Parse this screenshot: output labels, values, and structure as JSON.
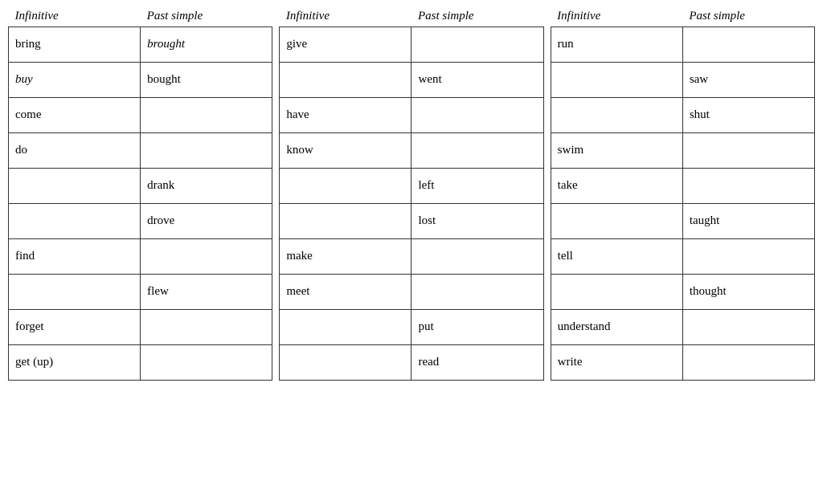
{
  "tables": [
    {
      "id": "table1",
      "headers": [
        "Infinitive",
        "Past simple"
      ],
      "rows": [
        {
          "infinitive": "bring",
          "infinitive_italic": false,
          "past_simple": "brought",
          "past_italic": true
        },
        {
          "infinitive": "buy",
          "infinitive_italic": true,
          "past_simple": "bought",
          "past_italic": false
        },
        {
          "infinitive": "come",
          "infinitive_italic": false,
          "past_simple": "",
          "past_italic": false
        },
        {
          "infinitive": "do",
          "infinitive_italic": false,
          "past_simple": "",
          "past_italic": false
        },
        {
          "infinitive": "",
          "infinitive_italic": false,
          "past_simple": "drank",
          "past_italic": false
        },
        {
          "infinitive": "",
          "infinitive_italic": false,
          "past_simple": "drove",
          "past_italic": false
        },
        {
          "infinitive": "find",
          "infinitive_italic": false,
          "past_simple": "",
          "past_italic": false
        },
        {
          "infinitive": "",
          "infinitive_italic": false,
          "past_simple": "flew",
          "past_italic": false
        },
        {
          "infinitive": "forget",
          "infinitive_italic": false,
          "past_simple": "",
          "past_italic": false
        },
        {
          "infinitive": "get (up)",
          "infinitive_italic": false,
          "past_simple": "",
          "past_italic": false
        }
      ]
    },
    {
      "id": "table2",
      "headers": [
        "Infinitive",
        "Past simple"
      ],
      "rows": [
        {
          "infinitive": "give",
          "infinitive_italic": false,
          "past_simple": "",
          "past_italic": false
        },
        {
          "infinitive": "",
          "infinitive_italic": false,
          "past_simple": "went",
          "past_italic": false
        },
        {
          "infinitive": "have",
          "infinitive_italic": false,
          "past_simple": "",
          "past_italic": false
        },
        {
          "infinitive": "know",
          "infinitive_italic": false,
          "past_simple": "",
          "past_italic": false
        },
        {
          "infinitive": "",
          "infinitive_italic": false,
          "past_simple": "left",
          "past_italic": false
        },
        {
          "infinitive": "",
          "infinitive_italic": false,
          "past_simple": "lost",
          "past_italic": false
        },
        {
          "infinitive": "make",
          "infinitive_italic": false,
          "past_simple": "",
          "past_italic": false
        },
        {
          "infinitive": "meet",
          "infinitive_italic": false,
          "past_simple": "",
          "past_italic": false
        },
        {
          "infinitive": "",
          "infinitive_italic": false,
          "past_simple": "put",
          "past_italic": false
        },
        {
          "infinitive": "",
          "infinitive_italic": false,
          "past_simple": "read",
          "past_italic": false
        }
      ]
    },
    {
      "id": "table3",
      "headers": [
        "Infinitive",
        "Past simple"
      ],
      "rows": [
        {
          "infinitive": "run",
          "infinitive_italic": false,
          "past_simple": "",
          "past_italic": false
        },
        {
          "infinitive": "",
          "infinitive_italic": false,
          "past_simple": "saw",
          "past_italic": false
        },
        {
          "infinitive": "",
          "infinitive_italic": false,
          "past_simple": "shut",
          "past_italic": false
        },
        {
          "infinitive": "swim",
          "infinitive_italic": false,
          "past_simple": "",
          "past_italic": false
        },
        {
          "infinitive": "take",
          "infinitive_italic": false,
          "past_simple": "",
          "past_italic": false
        },
        {
          "infinitive": "",
          "infinitive_italic": false,
          "past_simple": "taught",
          "past_italic": false
        },
        {
          "infinitive": "tell",
          "infinitive_italic": false,
          "past_simple": "",
          "past_italic": false
        },
        {
          "infinitive": "",
          "infinitive_italic": false,
          "past_simple": "thought",
          "past_italic": false
        },
        {
          "infinitive": "understand",
          "infinitive_italic": false,
          "past_simple": "",
          "past_italic": false
        },
        {
          "infinitive": "write",
          "infinitive_italic": false,
          "past_simple": "",
          "past_italic": false
        }
      ]
    }
  ]
}
